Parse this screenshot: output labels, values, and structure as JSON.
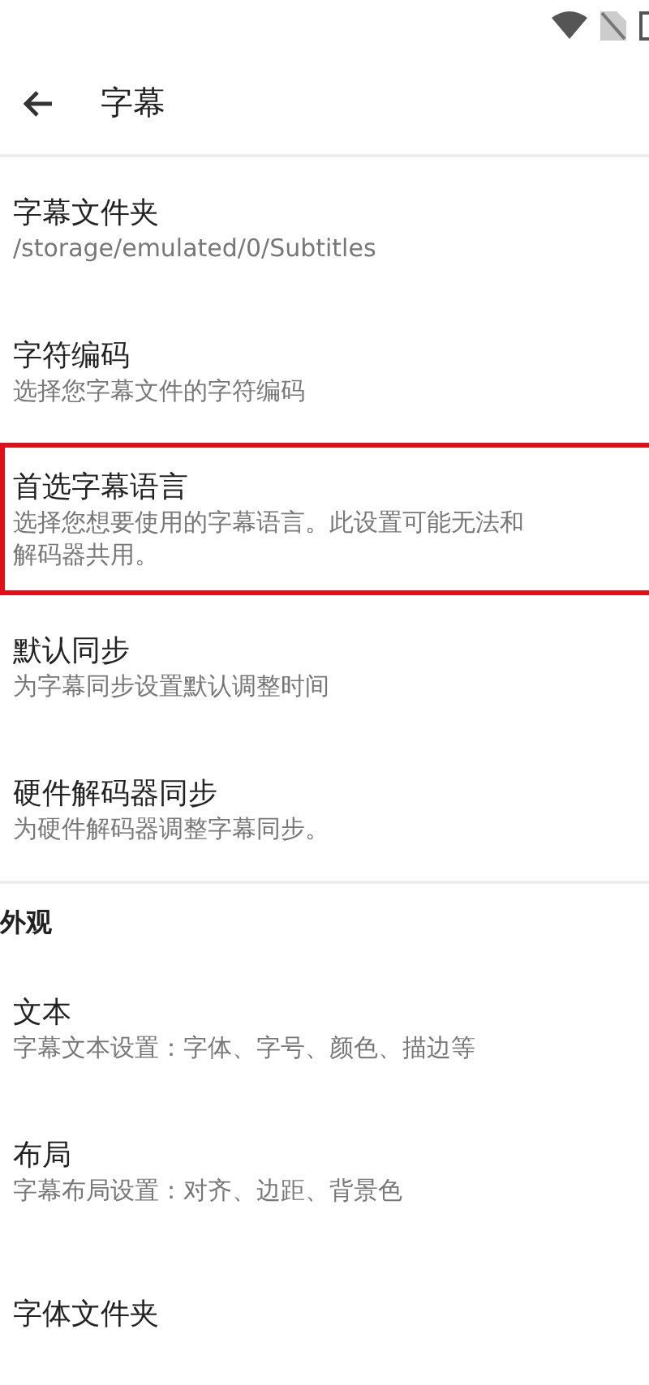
{
  "app_bar": {
    "title": "字幕"
  },
  "groups": [
    {
      "items": [
        {
          "title": "字幕文件夹",
          "summary": [
            "/storage/emulated/0/Subtitles"
          ],
          "highlighted": false
        },
        {
          "title": "字符编码",
          "summary": [
            "选择您字幕文件的字符编码"
          ],
          "highlighted": false
        },
        {
          "title": "首选字幕语言",
          "summary": [
            "选择您想要使用的字幕语言。此设置可能无法和",
            "解码器共用。"
          ],
          "highlighted": true
        },
        {
          "title": "默认同步",
          "summary": [
            "为字幕同步设置默认调整时间"
          ],
          "highlighted": false
        },
        {
          "title": "硬件解码器同步",
          "summary": [
            "为硬件解码器调整字幕同步。"
          ],
          "highlighted": false
        }
      ]
    },
    {
      "header": "外观",
      "items": [
        {
          "title": "文本",
          "summary": [
            "字幕文本设置：字体、字号、颜色、描边等"
          ],
          "highlighted": false
        },
        {
          "title": "布局",
          "summary": [
            "字幕布局设置：对齐、边距、背景色"
          ],
          "highlighted": false
        },
        {
          "title": "字体文件夹",
          "highlighted": false
        }
      ]
    }
  ]
}
